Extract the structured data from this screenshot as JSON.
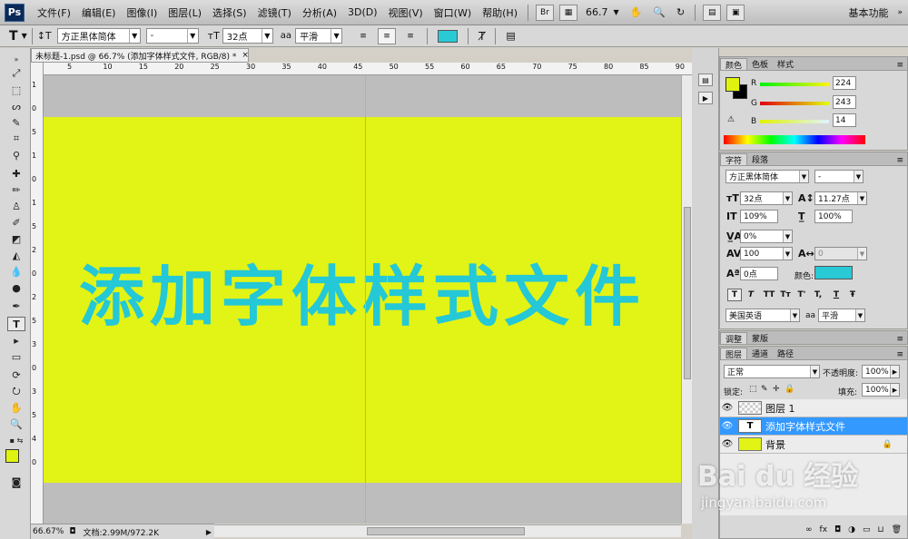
{
  "app": {
    "logo": "Ps"
  },
  "menu": {
    "items": [
      "文件(F)",
      "编辑(E)",
      "图像(I)",
      "图层(L)",
      "选择(S)",
      "滤镜(T)",
      "分析(A)",
      "3D(D)",
      "视图(V)",
      "窗口(W)",
      "帮助(H)"
    ]
  },
  "menubar_right": {
    "bridge": "Br",
    "zoom": "66.7",
    "workspace": "基本功能"
  },
  "options": {
    "tool_glyph": "T",
    "font_family": "方正黑体简体",
    "font_style": "-",
    "font_size": "32点",
    "aa_label": "aa",
    "aa_mode": "平滑",
    "text_color": "#29c9d6"
  },
  "document": {
    "tab_title": "未标题-1.psd @ 66.7% (添加字体样式文件, RGB/8) *",
    "canvas_text": "添加字体样式文件",
    "canvas_color": "#e2f316",
    "text_color": "#24c8d6",
    "ruler_top": [
      "5",
      "10",
      "15",
      "20",
      "25",
      "30",
      "35",
      "40",
      "45",
      "50",
      "55",
      "60",
      "65",
      "70",
      "75",
      "80",
      "85",
      "90"
    ],
    "ruler_left": [
      "1",
      "0",
      "5",
      "1",
      "0",
      "1",
      "5",
      "2",
      "0",
      "2",
      "5",
      "3",
      "0",
      "3",
      "5",
      "4",
      "0"
    ],
    "status_zoom": "66.67%",
    "status_doc": "文档:2.99M/972.2K"
  },
  "color_panel": {
    "tabs": [
      "颜色",
      "色板",
      "样式"
    ],
    "r_label": "R",
    "g_label": "G",
    "b_label": "B",
    "r": "224",
    "g": "243",
    "b": "14",
    "fg": "#e0f30e",
    "bg": "#000000"
  },
  "char_panel": {
    "tabs": [
      "字符",
      "段落"
    ],
    "font_family": "方正黑体简体",
    "font_style": "-",
    "size": "32点",
    "leading": "11.27点",
    "vscale": "109%",
    "hscale": "100%",
    "kerning": "0%",
    "tracking": "100",
    "kern_metrics": "0",
    "baseline": "0点",
    "color_label": "颜色:",
    "color": "#29c9d6",
    "style_buttons": [
      "T",
      "T",
      "TT",
      "Tт",
      "T'",
      "T,",
      "T",
      "Ŧ"
    ],
    "language": "美国英语",
    "aa_label": "aa",
    "aa_mode": "平滑"
  },
  "adjust_panel": {
    "tabs": [
      "调整",
      "蒙版"
    ]
  },
  "layers_panel": {
    "tabs": [
      "图层",
      "通道",
      "路径"
    ],
    "blend_mode": "正常",
    "opacity_label": "不透明度:",
    "opacity": "100%",
    "lock_label": "锁定:",
    "fill_label": "填充:",
    "fill": "100%",
    "layers": [
      {
        "name": "图层 1",
        "thumb": "",
        "selected": false
      },
      {
        "name": "添加字体样式文件",
        "thumb": "T",
        "selected": true
      },
      {
        "name": "背景",
        "thumb": "",
        "selected": false,
        "locked": true
      }
    ],
    "footer_icons": [
      "∞",
      "fx",
      "◘",
      "◑",
      "▭",
      "⊔",
      "🗑"
    ]
  },
  "watermark": {
    "logo": "Bai du 经验",
    "url": "jingyan.baidu.com"
  }
}
